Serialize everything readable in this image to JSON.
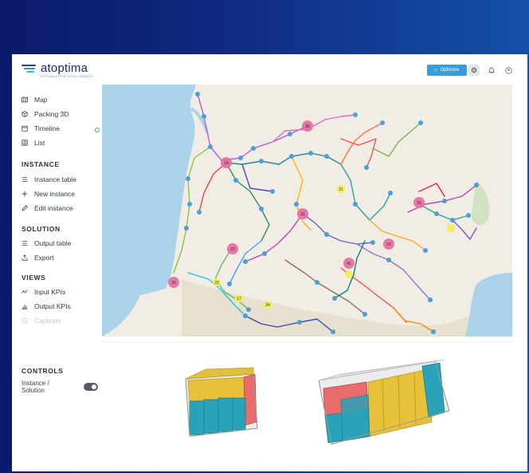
{
  "app": {
    "logo_name": "atoptima",
    "logo_tagline": "OPTIMIZATION INTELLIGENCE"
  },
  "toolbar": {
    "optimize_label": "Optimize"
  },
  "sidebar": {
    "views_top": [
      {
        "label": "Map",
        "icon": "map-icon"
      },
      {
        "label": "Packing 3D",
        "icon": "cube-icon"
      },
      {
        "label": "Timeline",
        "icon": "calendar-icon"
      },
      {
        "label": "List",
        "icon": "list-icon"
      }
    ],
    "instance": {
      "title": "INSTANCE",
      "items": [
        {
          "label": "Instance table",
          "icon": "table-icon"
        },
        {
          "label": "New instance",
          "icon": "plus-icon"
        },
        {
          "label": "Edit instance",
          "icon": "pencil-icon"
        }
      ]
    },
    "solution": {
      "title": "SOLUTION",
      "items": [
        {
          "label": "Output table",
          "icon": "table-icon"
        },
        {
          "label": "Export",
          "icon": "export-icon"
        }
      ]
    },
    "views": {
      "title": "VIEWS",
      "items": [
        {
          "label": "Input KPIs",
          "icon": "trend-icon"
        },
        {
          "label": "Output KPIs",
          "icon": "bar-chart-icon"
        },
        {
          "label": "Captions",
          "icon": "info-icon"
        }
      ]
    },
    "controls": {
      "title": "CONTROLS",
      "toggle_label_line1": "Instance /",
      "toggle_label_line2": "Solution"
    }
  },
  "map": {
    "cluster_labels": [
      "25",
      "19",
      "29",
      "22",
      "16",
      "41",
      "23",
      "26",
      "21",
      "22",
      "17",
      "24"
    ]
  },
  "colors": {
    "accent": "#3a9ddb",
    "brand_dark": "#1d2c66",
    "sea": "#aad3ea",
    "cluster_pink": "#e86aa2",
    "cluster_yellow": "#f3ec5d",
    "container_yellow": "#e7c13a",
    "container_teal": "#2aa3b8",
    "container_red": "#e96c6c"
  }
}
